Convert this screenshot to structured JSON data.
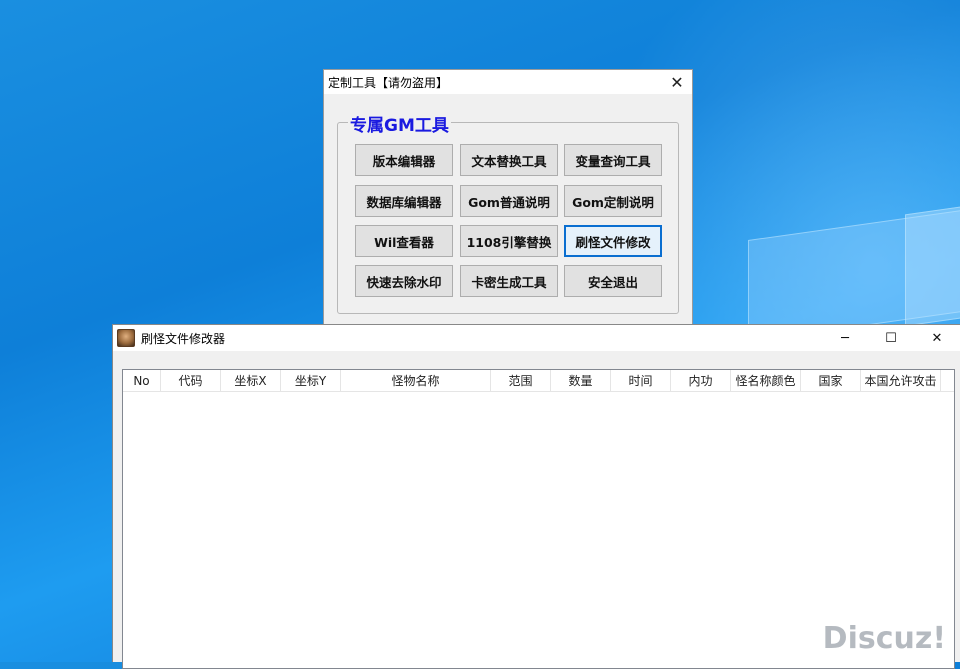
{
  "window1": {
    "title": "定制工具【请勿盗用】",
    "group_title": "专属GM工具",
    "buttons": [
      {
        "label": "版本编辑器"
      },
      {
        "label": "文本替换工具"
      },
      {
        "label": "变量查询工具"
      },
      {
        "label": "数据库编辑器"
      },
      {
        "label": "Gom普通说明"
      },
      {
        "label": "Gom定制说明"
      },
      {
        "label": "Wil查看器"
      },
      {
        "label": "1108引擎替换"
      },
      {
        "label": "刷怪文件修改"
      },
      {
        "label": "快速去除水印"
      },
      {
        "label": "卡密生成工具"
      },
      {
        "label": "安全退出"
      }
    ],
    "focused_button": "刷怪文件修改"
  },
  "window2": {
    "title": "刷怪文件修改器",
    "columns": [
      "No",
      "代码",
      "坐标X",
      "坐标Y",
      "怪物名称",
      "范围",
      "数量",
      "时间",
      "内功",
      "怪名称颜色",
      "国家",
      "本国允许攻击"
    ],
    "rows": []
  },
  "watermark": "Discuz!"
}
